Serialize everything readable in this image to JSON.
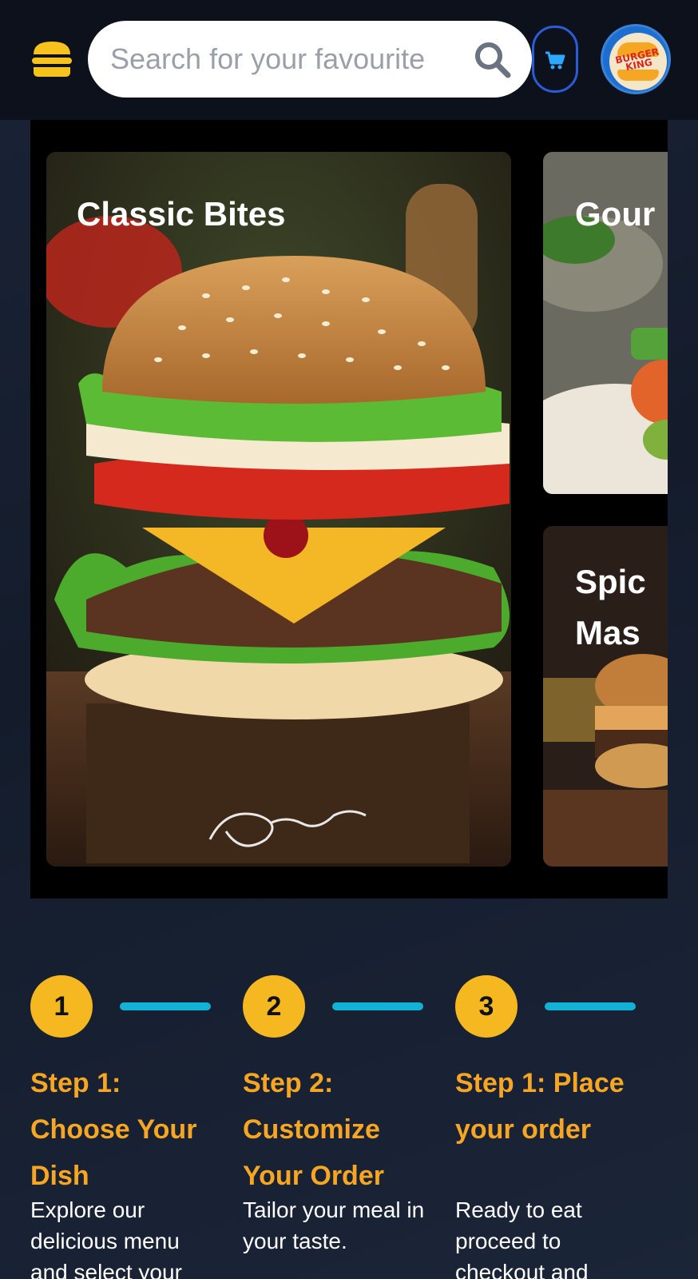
{
  "header": {
    "search": {
      "placeholder": "Search for your favourite"
    },
    "logo": {
      "text": "BURGER KING"
    }
  },
  "carousel": {
    "cards": [
      {
        "title": "Classic Bites",
        "signature": "Maz"
      },
      {
        "title": "Gour"
      },
      {
        "title": "Spic\nMas"
      }
    ]
  },
  "steps": [
    {
      "number": "1",
      "title": "Step 1: Choose Your Dish",
      "description": "Explore our delicious menu and select your"
    },
    {
      "number": "2",
      "title": "Step 2: Customize Your Order",
      "description": "Tailor your meal in your taste."
    },
    {
      "number": "3",
      "title": "Step 1: Place your order",
      "description": "Ready to eat proceed to checkout and"
    }
  ],
  "colors": {
    "accent": "#f6b820",
    "step_title": "#f6a623",
    "step_line": "#12b1d6",
    "cart_border": "#2b5bd6",
    "background": "#141c2c"
  }
}
